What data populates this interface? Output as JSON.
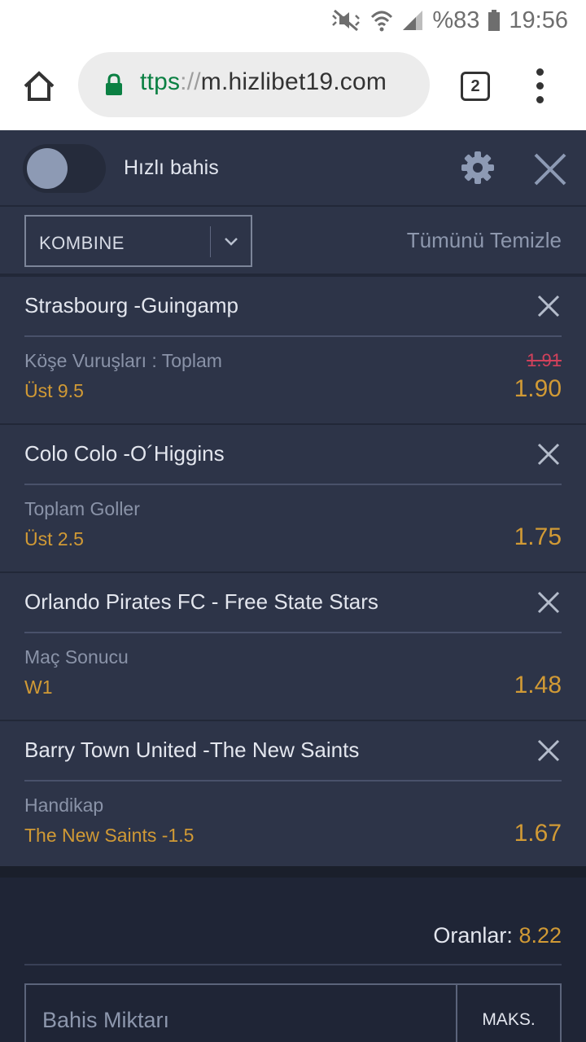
{
  "status_bar": {
    "battery": "%83",
    "time": "19:56"
  },
  "browser": {
    "url_protocol": "ttps",
    "url_separator": "://",
    "url_host": "m.hizlibet19.com",
    "tab_count": "2"
  },
  "header": {
    "quick_bet_label": "Hızlı bahis",
    "quick_bet_enabled": false
  },
  "controls": {
    "bet_type": "KOMBINE",
    "clear_all": "Tümünü Temizle"
  },
  "bets": [
    {
      "match": "Strasbourg -Guingamp",
      "market": "Köşe Vuruşları : Toplam",
      "pick": "Üst 9.5",
      "old_odd": "1.91",
      "odd": "1.90"
    },
    {
      "match": "Colo Colo -O´Higgins",
      "market": "Toplam Goller",
      "pick": "Üst 2.5",
      "odd": "1.75"
    },
    {
      "match": "Orlando Pirates FC - Free State Stars",
      "market": "Maç Sonucu",
      "pick": "W1",
      "odd": "1.48"
    },
    {
      "match": "Barry Town United -The New Saints",
      "market": "Handikap",
      "pick": "The New Saints -1.5",
      "odd": "1.67"
    }
  ],
  "footer": {
    "odds_label": "Oranlar:",
    "odds_value": "8.22",
    "stake_placeholder": "Bahis Miktarı",
    "max_button": "MAKS."
  },
  "colors": {
    "background": "#2d3448",
    "accent": "#d19a35",
    "changed_odd": "#d2415b",
    "text": "#e3e6ee",
    "muted": "#8a93a8"
  }
}
